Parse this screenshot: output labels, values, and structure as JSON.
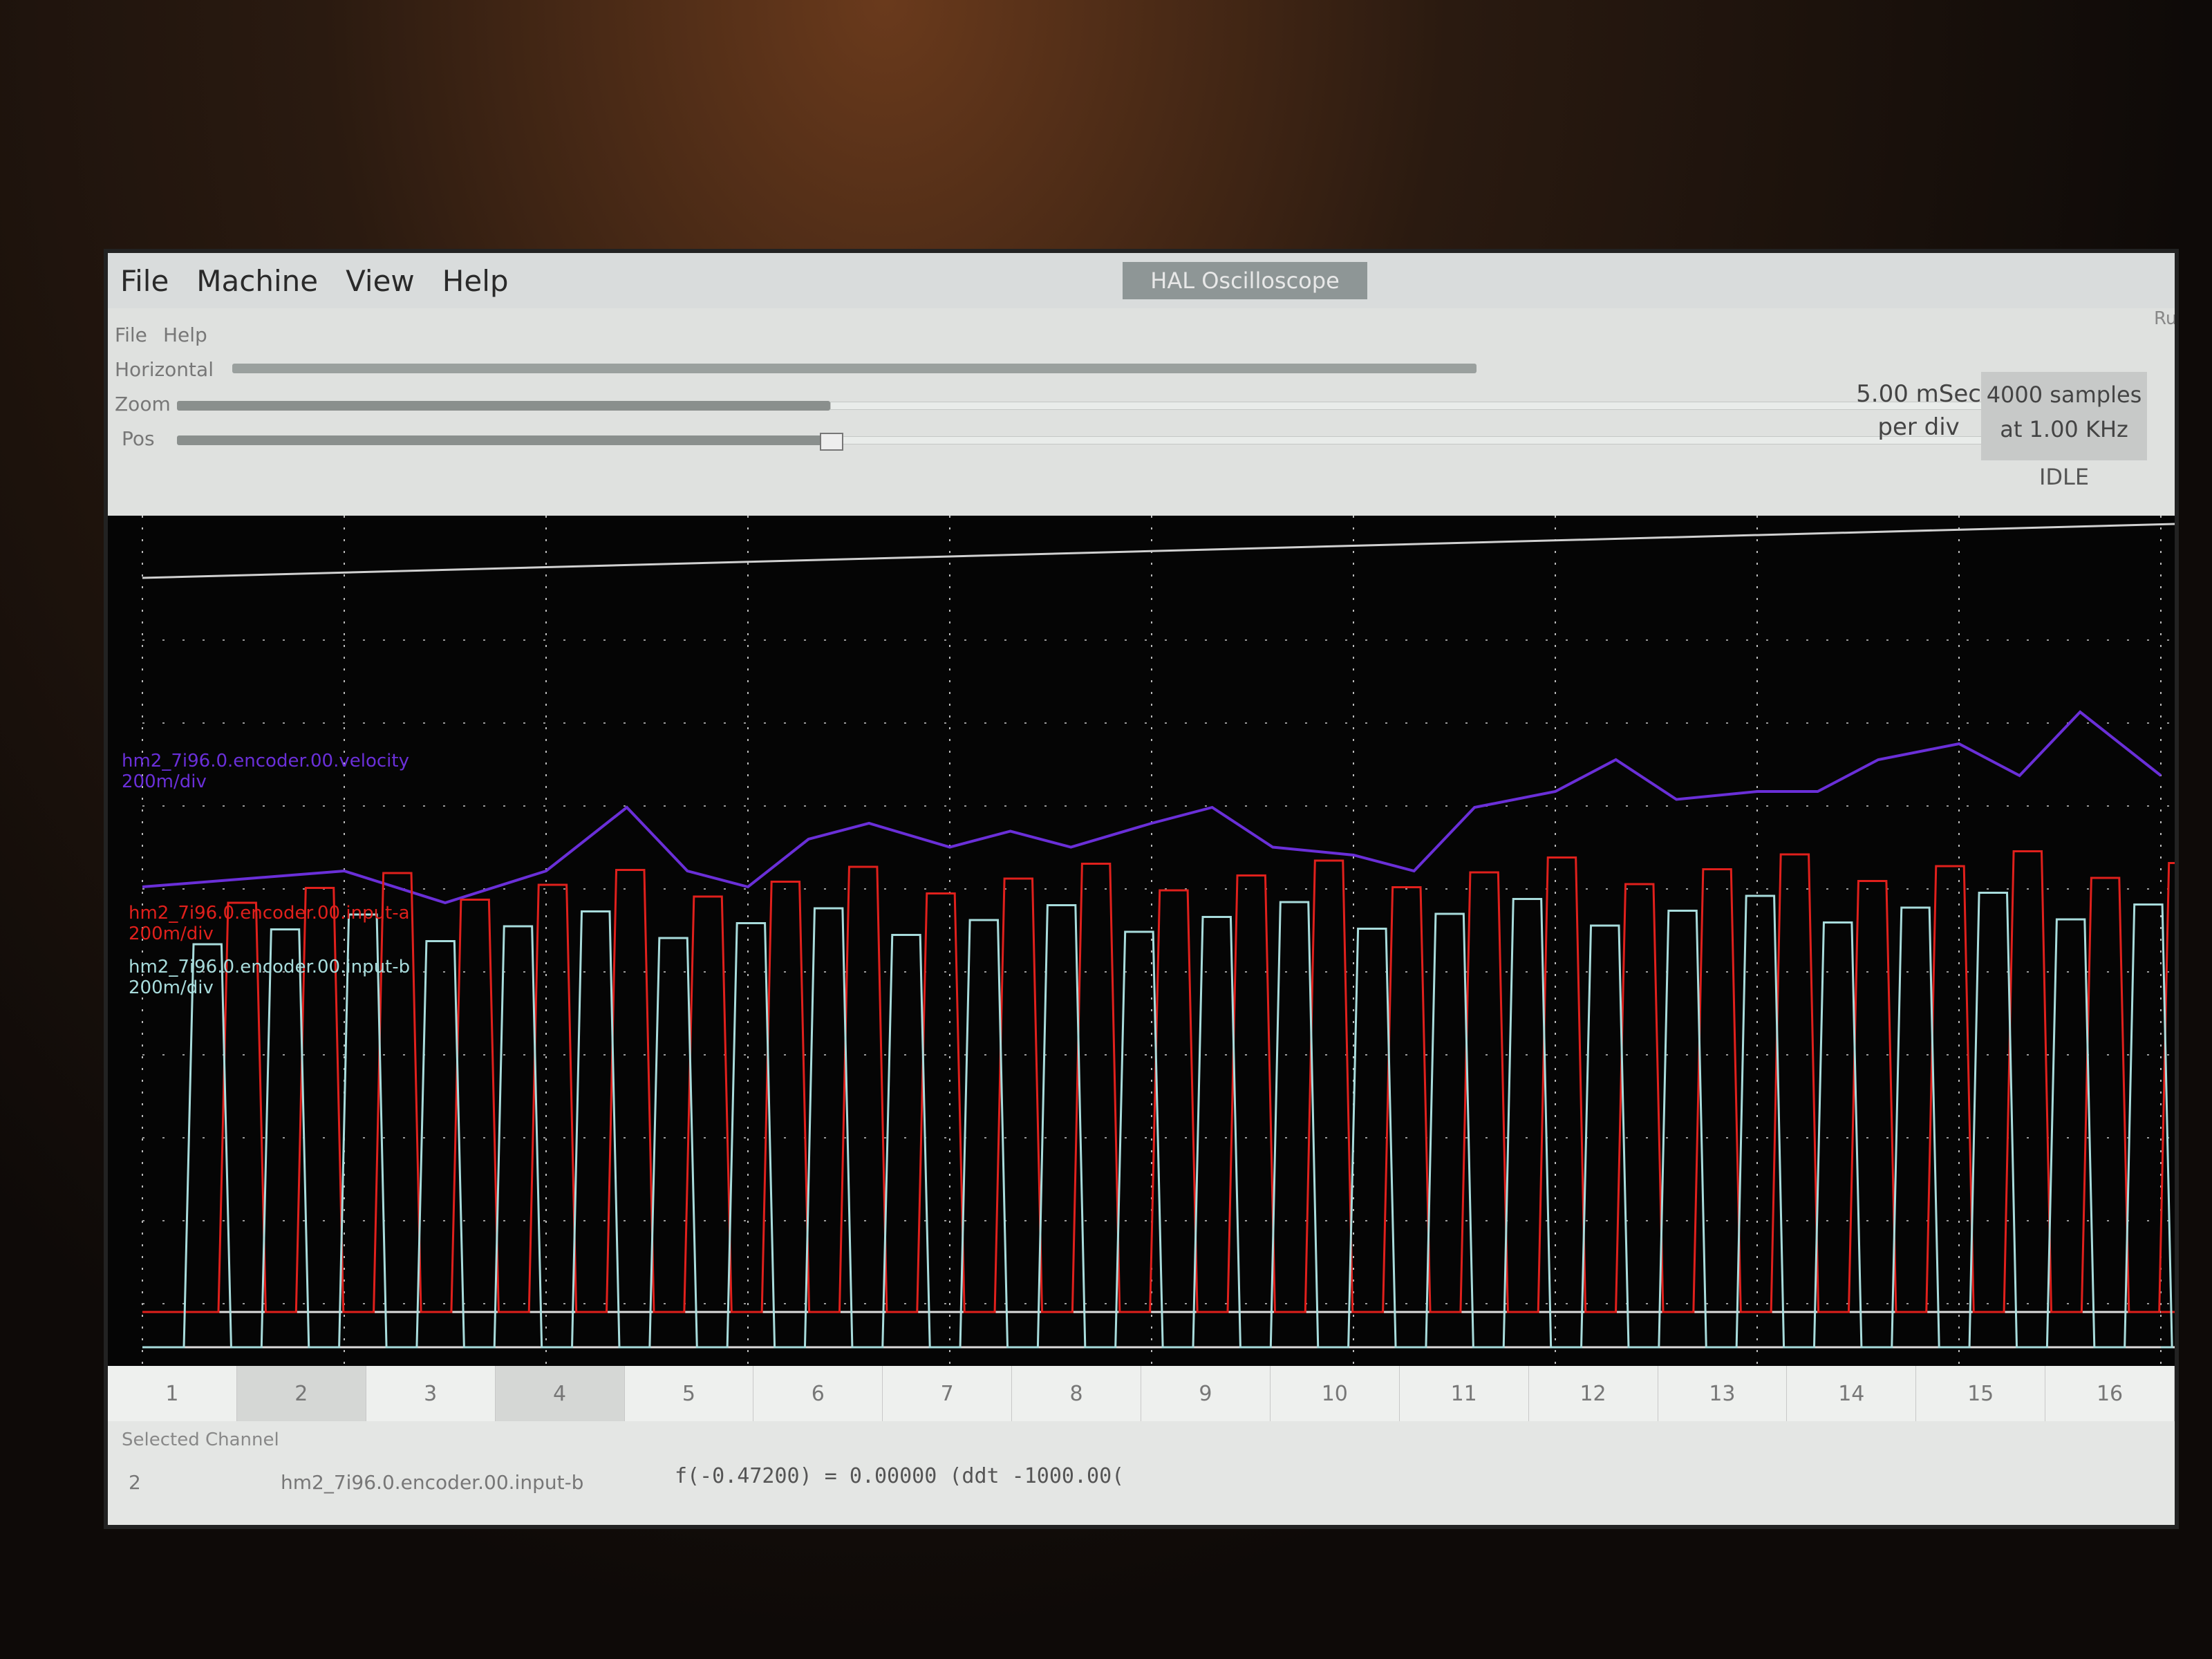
{
  "menubar": {
    "items": [
      "File",
      "Machine",
      "View",
      "Help"
    ]
  },
  "window": {
    "title": "HAL Oscilloscope"
  },
  "scope_menu": {
    "items": [
      "File",
      "Help"
    ]
  },
  "horizontal": {
    "section_label": "Horizontal",
    "zoom_label": "Zoom",
    "pos_label": "Pos",
    "rate_value": "5.00 mSec",
    "rate_unit": "per div",
    "samples": "4000 samples",
    "sample_rate": "at 1.00 KHz",
    "state": "IDLE",
    "zoom_fraction": 0.35,
    "pos_fraction": 0.35
  },
  "channels": {
    "velocity": {
      "name": "hm2_7i96.0.encoder.00.velocity",
      "scale": "200m/div",
      "color": "#6a2fd8"
    },
    "input_a": {
      "name": "hm2_7i96.0.encoder.00.input-a",
      "scale": "200m/div",
      "color": "#e0201c"
    },
    "input_b": {
      "name": "hm2_7i96.0.encoder.00.input-b",
      "scale": "200m/div",
      "color": "#a8dcdc"
    }
  },
  "channel_buttons": [
    "1",
    "2",
    "3",
    "4",
    "5",
    "6",
    "7",
    "8",
    "9",
    "10",
    "11",
    "12",
    "13",
    "14",
    "15",
    "16"
  ],
  "selected_channel": {
    "title": "Selected Channel",
    "number": "2",
    "name": "hm2_7i96.0.encoder.00.input-b",
    "readout": "f(-0.47200) =  0.00000 (ddt -1000.00("
  },
  "side_cut": "Ru",
  "chart_data": {
    "type": "line",
    "x_divisions": 10,
    "series": [
      {
        "name": "hm2_7i96.0.encoder.00.velocity",
        "x": [
          0,
          0.05,
          0.1,
          0.15,
          0.2,
          0.22,
          0.24,
          0.27,
          0.3,
          0.33,
          0.36,
          0.4,
          0.43,
          0.46,
          0.5,
          0.53,
          0.56,
          0.6,
          0.63,
          0.66,
          0.7,
          0.73,
          0.76,
          0.8,
          0.83,
          0.86,
          0.9,
          0.93,
          0.96,
          1
        ],
        "values": [
          0.22,
          0.23,
          0.24,
          0.2,
          0.24,
          0.28,
          0.32,
          0.24,
          0.22,
          0.28,
          0.3,
          0.27,
          0.29,
          0.27,
          0.3,
          0.32,
          0.27,
          0.26,
          0.24,
          0.32,
          0.34,
          0.38,
          0.33,
          0.34,
          0.34,
          0.38,
          0.4,
          0.36,
          0.44,
          0.36
        ]
      }
    ]
  }
}
